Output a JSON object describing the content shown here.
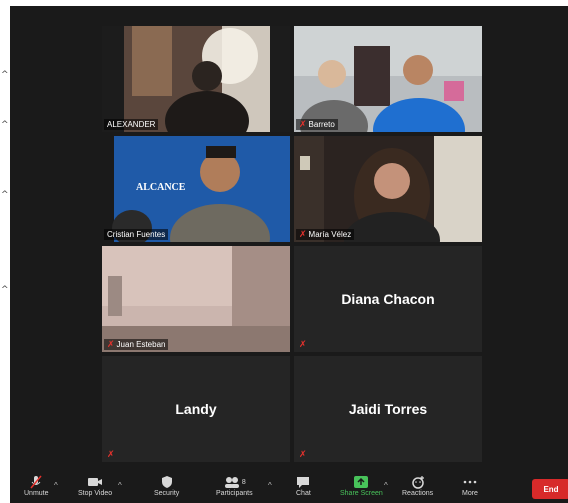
{
  "edge_glyphs": [
    "^",
    "^",
    "^",
    "^"
  ],
  "participants": [
    {
      "name": "ALEXANDER",
      "muted": false,
      "active": true,
      "video": true
    },
    {
      "name": "Barreto",
      "muted": true,
      "active": false,
      "video": true
    },
    {
      "name": "Cristian Fuentes",
      "muted": false,
      "active": false,
      "video": true,
      "banner_text": "ALCANCE"
    },
    {
      "name": "María Vélez",
      "muted": true,
      "active": false,
      "video": true
    },
    {
      "name": "Juan Esteban",
      "muted": true,
      "active": false,
      "video": true
    },
    {
      "name": "Diana Chacon",
      "muted": true,
      "active": false,
      "video": false
    },
    {
      "name": "Landy",
      "muted": true,
      "active": false,
      "video": false
    },
    {
      "name": "Jaidi Torres",
      "muted": true,
      "active": false,
      "video": false
    }
  ],
  "toolbar": {
    "unmute": "Unmute",
    "stop_video": "Stop Video",
    "security": "Security",
    "participants": "Participants",
    "participants_count": "8",
    "chat": "Chat",
    "share_screen": "Share Screen",
    "reactions": "Reactions",
    "more": "More",
    "end": "End"
  },
  "colors": {
    "active_border": "#c8e06a",
    "share_green": "#48c25a",
    "end_red": "#d72a2a",
    "mute_red": "#e5322d"
  }
}
